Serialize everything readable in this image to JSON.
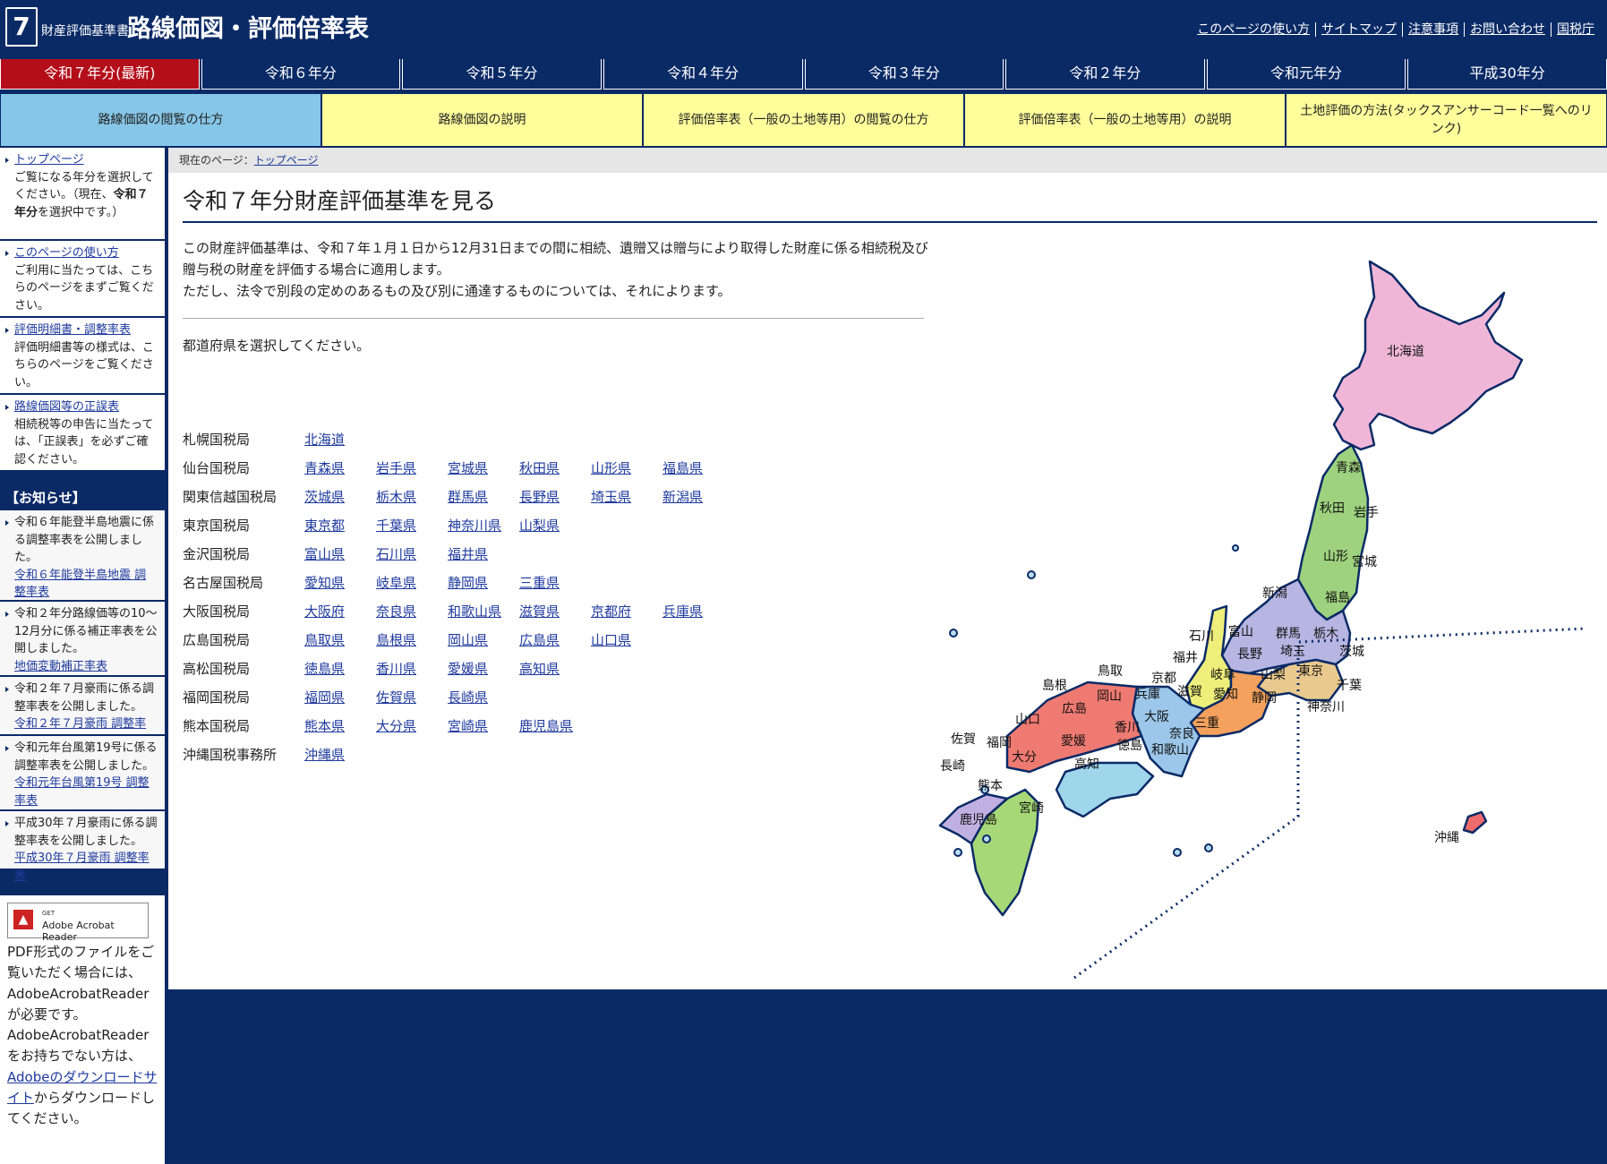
{
  "header": {
    "logo_number": "7",
    "subtitle": "財産評価基準書",
    "title": "路線価図・評価倍率表",
    "links": [
      "このページの使い方",
      "サイトマップ",
      "注意事項",
      "お問い合わせ",
      "国税庁"
    ]
  },
  "year_tabs": [
    "令和７年分(最新)",
    "令和６年分",
    "令和５年分",
    "令和４年分",
    "令和３年分",
    "令和２年分",
    "令和元年分",
    "平成30年分"
  ],
  "guide_tabs": [
    "路線価図の閲覧の仕方",
    "路線価図の説明",
    "評価倍率表（一般の土地等用）の閲覧の仕方",
    "評価倍率表（一般の土地等用）の説明",
    "土地評価の方法(タックスアンサーコード一覧へのリンク)"
  ],
  "sidebar": {
    "items": [
      {
        "link": "トップページ",
        "text_before": "ご覧になる年分を選択してください。（現在、",
        "bold": "令和７年分",
        "text_after": "を選択中です。）"
      },
      {
        "link": "このページの使い方",
        "text": "ご利用に当たっては、こちらのページをまずご覧ください。"
      },
      {
        "link": "評価明細書・調整率表",
        "text": "評価明細書等の様式は、こちらのページをご覧ください。"
      },
      {
        "link": "路線価図等の正誤表",
        "text": "相続税等の申告に当たっては、「正誤表」を必ずご確認ください。"
      }
    ],
    "news_heading": "【お知らせ】",
    "news": [
      {
        "text": "令和６年能登半島地震に係る調整率表を公開しました。",
        "link": "令和６年能登半島地震 調整率表"
      },
      {
        "text": "令和２年分路線価等の10～12月分に係る補正率表を公開しました。",
        "link": "地価変動補正率表"
      },
      {
        "text": "令和２年７月豪雨に係る調整率表を公開しました。",
        "link": "令和２年７月豪雨 調整率表"
      },
      {
        "text": "令和元年台風第19号に係る調整率表を公開しました。",
        "link": "令和元年台風第19号 調整率表"
      },
      {
        "text": "平成30年７月豪雨に係る調整率表を公開しました。",
        "link": "平成30年７月豪雨 調整率表"
      }
    ],
    "reader": {
      "badge_get": "GET",
      "badge_name": "Adobe Acrobat Reader",
      "text1": "PDF形式のファイルをご覧いただく場合には、AdobeAcrobatReaderが必要です。AdobeAcrobatReaderをお持ちでない方は、",
      "link": "Adobeのダウンロードサイト",
      "text2": "からダウンロードしてください。"
    }
  },
  "main": {
    "breadcrumb_prefix": "現在のページ：",
    "breadcrumb_link": "トップページ",
    "title": "令和７年分財産評価基準を見る",
    "intro1": "この財産評価基準は、令和７年１月１日から12月31日までの間に相続、遺贈又は贈与により取得した財産に係る相続税及び贈与税の財産を評価する場合に適用します。",
    "intro2": "ただし、法令で別段の定めのあるもの及び別に通達するものについては、それによります。",
    "select_prompt": "都道府県を選択してください。",
    "bureaus": [
      {
        "name": "札幌国税局",
        "prefs": [
          "北海道"
        ]
      },
      {
        "name": "仙台国税局",
        "prefs": [
          "青森県",
          "岩手県",
          "宮城県",
          "秋田県",
          "山形県",
          "福島県"
        ]
      },
      {
        "name": "関東信越国税局",
        "prefs": [
          "茨城県",
          "栃木県",
          "群馬県",
          "長野県",
          "埼玉県",
          "新潟県"
        ]
      },
      {
        "name": "東京国税局",
        "prefs": [
          "東京都",
          "千葉県",
          "神奈川県",
          "山梨県"
        ]
      },
      {
        "name": "金沢国税局",
        "prefs": [
          "富山県",
          "石川県",
          "福井県"
        ]
      },
      {
        "name": "名古屋国税局",
        "prefs": [
          "愛知県",
          "岐阜県",
          "静岡県",
          "三重県"
        ]
      },
      {
        "name": "大阪国税局",
        "prefs": [
          "大阪府",
          "奈良県",
          "和歌山県",
          "滋賀県",
          "京都府",
          "兵庫県"
        ]
      },
      {
        "name": "広島国税局",
        "prefs": [
          "鳥取県",
          "島根県",
          "岡山県",
          "広島県",
          "山口県"
        ]
      },
      {
        "name": "高松国税局",
        "prefs": [
          "徳島県",
          "香川県",
          "愛媛県",
          "高知県"
        ]
      },
      {
        "name": "福岡国税局",
        "prefs": [
          "福岡県",
          "佐賀県",
          "長崎県"
        ]
      },
      {
        "name": "熊本国税局",
        "prefs": [
          "熊本県",
          "大分県",
          "宮崎県",
          "鹿児島県"
        ]
      },
      {
        "name": "沖縄国税事務所",
        "prefs": [
          "沖縄県"
        ]
      }
    ],
    "map": {
      "regions": [
        {
          "id": "hokkaido",
          "color": "#f0b6d8"
        },
        {
          "id": "tohoku",
          "color": "#9ed27e"
        },
        {
          "id": "kanto",
          "color": "#b7b5e2"
        },
        {
          "id": "tokyo",
          "color": "#e9c98e"
        },
        {
          "id": "hokuriku",
          "color": "#eeee7a"
        },
        {
          "id": "chubu",
          "color": "#f3a15c"
        },
        {
          "id": "kinki",
          "color": "#9cc7ea"
        },
        {
          "id": "chugoku",
          "color": "#ef7a72"
        },
        {
          "id": "shikoku",
          "color": "#9fd6ec"
        },
        {
          "id": "kyushu",
          "color": "#a7d877"
        },
        {
          "id": "fukuoka",
          "color": "#c0b0e2"
        },
        {
          "id": "okinawa",
          "color": "#ef6a6a"
        }
      ],
      "labels": [
        "北海道",
        "青森",
        "秋田",
        "岩手",
        "山形",
        "宮城",
        "新潟",
        "福島",
        "石川",
        "富山",
        "群馬",
        "栃木",
        "茨城",
        "福井",
        "長野",
        "埼玉",
        "京都",
        "岐阜",
        "山梨",
        "東京",
        "千葉",
        "鳥取",
        "島根",
        "岡山",
        "兵庫",
        "滋賀",
        "愛知",
        "静岡",
        "神奈川",
        "大阪",
        "三重",
        "山口",
        "広島",
        "香川",
        "奈良",
        "和歌山",
        "徳島",
        "佐賀",
        "福岡",
        "愛媛",
        "大分",
        "高知",
        "長崎",
        "熊本",
        "宮崎",
        "鹿児島",
        "沖縄"
      ]
    }
  }
}
